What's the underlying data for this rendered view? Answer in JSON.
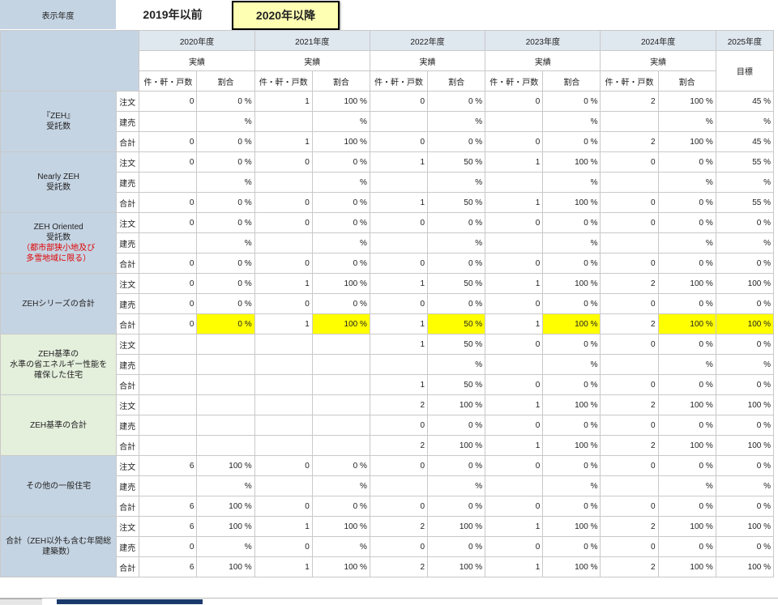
{
  "toolbar": {
    "label": "表示年度",
    "buttons": [
      "2019年以前",
      "2020年以降"
    ],
    "selected_index": 1
  },
  "table": {
    "years": [
      "2020年度",
      "2021年度",
      "2022年度",
      "2023年度",
      "2024年度",
      "2025年度"
    ],
    "actual_label": "実績",
    "target_label": "目標",
    "count_label": "件・軒・戸数",
    "ratio_label": "割合",
    "sub_labels": [
      "注文",
      "建売",
      "合計"
    ],
    "groups": [
      {
        "title": [
          "『ZEH』",
          "受託数"
        ],
        "note": [],
        "color": "blue",
        "rows": [
          {
            "values": [
              "0",
              "0 %",
              "1",
              "100 %",
              "0",
              "0 %",
              "0",
              "0 %",
              "2",
              "100 %",
              "45 %"
            ]
          },
          {
            "values": [
              "",
              "%",
              "",
              "%",
              "",
              "%",
              "",
              "%",
              "",
              "%",
              "%"
            ]
          },
          {
            "values": [
              "0",
              "0 %",
              "1",
              "100 %",
              "0",
              "0 %",
              "0",
              "0 %",
              "2",
              "100 %",
              "45 %"
            ]
          }
        ]
      },
      {
        "title": [
          "Nearly ZEH",
          "受託数"
        ],
        "note": [],
        "color": "blue",
        "rows": [
          {
            "values": [
              "0",
              "0 %",
              "0",
              "0 %",
              "1",
              "50 %",
              "1",
              "100 %",
              "0",
              "0 %",
              "55 %"
            ]
          },
          {
            "values": [
              "",
              "%",
              "",
              "%",
              "",
              "%",
              "",
              "%",
              "",
              "%",
              "%"
            ]
          },
          {
            "values": [
              "0",
              "0 %",
              "0",
              "0 %",
              "1",
              "50 %",
              "1",
              "100 %",
              "0",
              "0 %",
              "55 %"
            ]
          }
        ]
      },
      {
        "title": [
          "ZEH Oriented",
          "受託数"
        ],
        "note": [
          "（都市部狭小地及び",
          "多雪地域に限る）"
        ],
        "color": "blue",
        "rows": [
          {
            "values": [
              "0",
              "0 %",
              "0",
              "0 %",
              "0",
              "0 %",
              "0",
              "0 %",
              "0",
              "0 %",
              "0 %"
            ]
          },
          {
            "values": [
              "",
              "%",
              "",
              "%",
              "",
              "%",
              "",
              "%",
              "",
              "%",
              "%"
            ]
          },
          {
            "values": [
              "0",
              "0 %",
              "0",
              "0 %",
              "0",
              "0 %",
              "0",
              "0 %",
              "0",
              "0 %",
              "0 %"
            ]
          }
        ]
      },
      {
        "title": [
          "ZEHシリーズの合計"
        ],
        "note": [],
        "color": "blue",
        "rows": [
          {
            "values": [
              "0",
              "0 %",
              "1",
              "100 %",
              "1",
              "50 %",
              "1",
              "100 %",
              "2",
              "100 %",
              "100 %"
            ]
          },
          {
            "values": [
              "0",
              "0 %",
              "0",
              "0 %",
              "0",
              "0 %",
              "0",
              "0 %",
              "0",
              "0 %",
              "0 %"
            ]
          },
          {
            "values": [
              "0",
              "0 %",
              "1",
              "100 %",
              "1",
              "50 %",
              "1",
              "100 %",
              "2",
              "100 %",
              "100 %"
            ],
            "highlight": true
          }
        ]
      },
      {
        "title": [
          "ZEH基準の",
          "水準の省エネルギー性能を",
          "確保した住宅"
        ],
        "note": [],
        "color": "green",
        "rows": [
          {
            "values": [
              "",
              "",
              "",
              "",
              "1",
              "50 %",
              "0",
              "0 %",
              "0",
              "0 %",
              "0 %"
            ]
          },
          {
            "values": [
              "",
              "",
              "",
              "",
              "",
              "%",
              "",
              "%",
              "",
              "%",
              "%"
            ]
          },
          {
            "values": [
              "",
              "",
              "",
              "",
              "1",
              "50 %",
              "0",
              "0 %",
              "0",
              "0 %",
              "0 %"
            ]
          }
        ]
      },
      {
        "title": [
          "ZEH基準の合計"
        ],
        "note": [],
        "color": "green",
        "rows": [
          {
            "values": [
              "",
              "",
              "",
              "",
              "2",
              "100 %",
              "1",
              "100 %",
              "2",
              "100 %",
              "100 %"
            ]
          },
          {
            "values": [
              "",
              "",
              "",
              "",
              "0",
              "0 %",
              "0",
              "0 %",
              "0",
              "0 %",
              "0 %"
            ]
          },
          {
            "values": [
              "",
              "",
              "",
              "",
              "2",
              "100 %",
              "1",
              "100 %",
              "2",
              "100 %",
              "100 %"
            ]
          }
        ]
      },
      {
        "title": [
          "その他の一般住宅"
        ],
        "note": [],
        "color": "blue",
        "rows": [
          {
            "values": [
              "6",
              "100 %",
              "0",
              "0 %",
              "0",
              "0 %",
              "0",
              "0 %",
              "0",
              "0 %",
              "0 %"
            ]
          },
          {
            "values": [
              "",
              "%",
              "",
              "%",
              "",
              "%",
              "",
              "%",
              "",
              "%",
              "%"
            ]
          },
          {
            "values": [
              "6",
              "100 %",
              "0",
              "0 %",
              "0",
              "0 %",
              "0",
              "0 %",
              "0",
              "0 %",
              "0 %"
            ]
          }
        ]
      },
      {
        "title": [
          "合計（ZEH以外も含む年間総",
          "建築数）"
        ],
        "note": [],
        "color": "blue",
        "rows": [
          {
            "values": [
              "6",
              "100 %",
              "1",
              "100 %",
              "2",
              "100 %",
              "1",
              "100 %",
              "2",
              "100 %",
              "100 %"
            ]
          },
          {
            "values": [
              "0",
              "%",
              "0",
              "%",
              "0",
              "0 %",
              "0",
              "0 %",
              "0",
              "0 %",
              "0 %"
            ]
          },
          {
            "values": [
              "6",
              "100 %",
              "1",
              "100 %",
              "2",
              "100 %",
              "1",
              "100 %",
              "2",
              "100 %",
              "100 %"
            ]
          }
        ]
      }
    ]
  }
}
